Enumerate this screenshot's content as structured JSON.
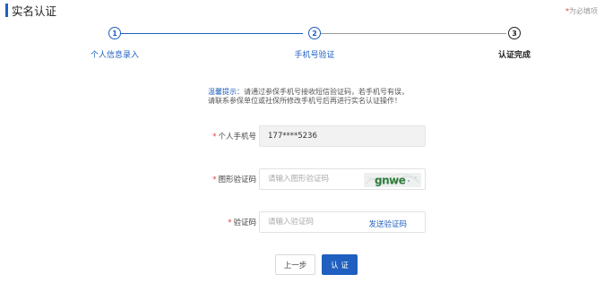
{
  "header": {
    "title": "实名认证",
    "required_note": "为必填项"
  },
  "steps": [
    {
      "number": "1",
      "label": "个人信息录入",
      "state": "complete"
    },
    {
      "number": "2",
      "label": "手机号验证",
      "state": "active"
    },
    {
      "number": "3",
      "label": "认证完成",
      "state": "pending"
    }
  ],
  "tip": {
    "label": "温馨提示：",
    "line1": "请通过参保手机号接收短信验证码，若手机号有误，",
    "line2": "请联系参保单位或社保所修改手机号后再进行实名认证操作！"
  },
  "form": {
    "phone": {
      "label": "个人手机号",
      "value": "177****5236"
    },
    "captcha": {
      "label": "图形验证码",
      "placeholder": "请输入图形验证码",
      "image_text": "gnwe"
    },
    "sms_code": {
      "label": "验证码",
      "placeholder": "请输入验证码",
      "send_label": "发送验证码"
    }
  },
  "buttons": {
    "prev_label": "上一步",
    "submit_label": "认 证"
  },
  "colors": {
    "accent": "#1f5fbf",
    "required_star": "#e23c3c"
  }
}
